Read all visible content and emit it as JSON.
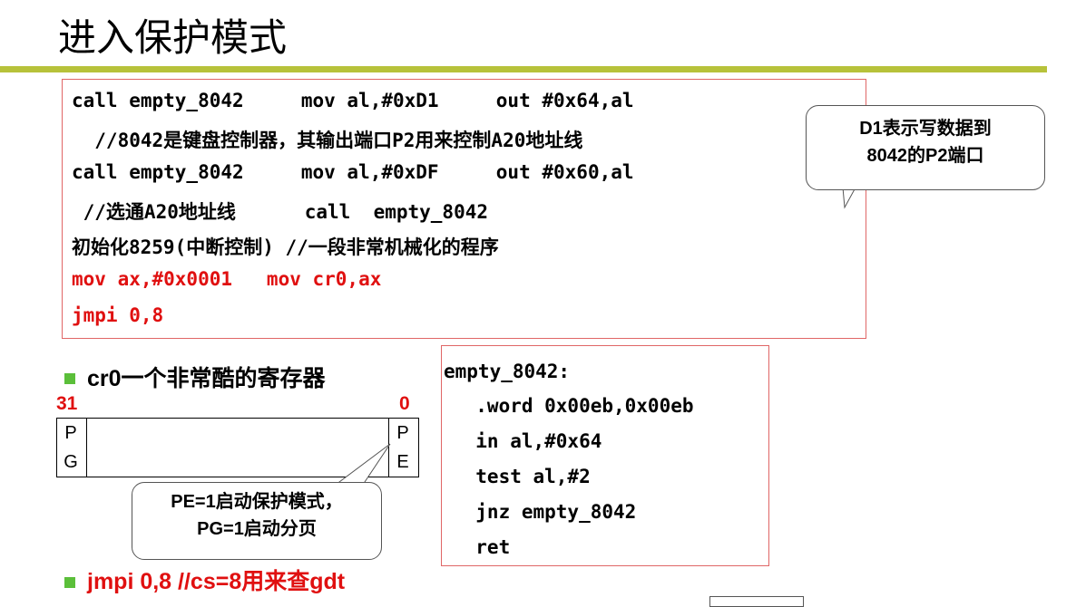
{
  "title": "进入保护模式",
  "code_box": {
    "lines": [
      "call empty_8042     mov al,#0xD1     out #0x64,al",
      "  //8042是键盘控制器，其输出端口P2用来控制A20地址线",
      "call empty_8042     mov al,#0xDF     out #0x60,al",
      " //选通A20地址线      call  empty_8042",
      "初始化8259(中断控制) //一段非常机械化的程序",
      "mov ax,#0x0001   mov cr0,ax",
      "jmpi 0,8"
    ]
  },
  "callout_d1": {
    "line1": "D1表示写数据到",
    "line2": "8042的P2端口"
  },
  "bullet_cr0": "cr0一个非常酷的寄存器",
  "register": {
    "bit_high": "31",
    "bit_low": "0",
    "pg1": "P",
    "pg2": "G",
    "pe1": "P",
    "pe2": "E"
  },
  "callout_pe": {
    "line1": "PE=1启动保护模式，",
    "line2": "PG=1启动分页"
  },
  "bullet_jmpi": "jmpi 0,8 //cs=8用来查gdt",
  "empty_box": {
    "lines": [
      "empty_8042:",
      "  .word 0x00eb,0x00eb",
      "  in al,#0x64",
      "  test al,#2",
      "  jnz empty_8042",
      "  ret"
    ]
  },
  "colors": {
    "accent": "#b7c23a",
    "red": "#e01010",
    "border": "#e06666",
    "bullet": "#5bbf3a"
  }
}
